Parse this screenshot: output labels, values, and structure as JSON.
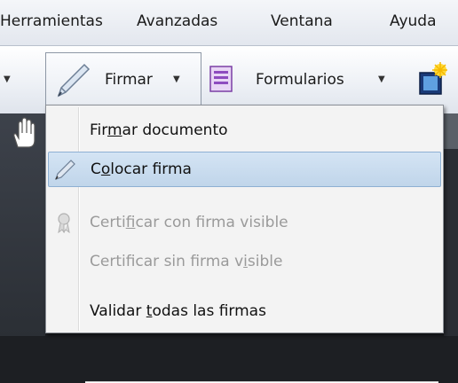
{
  "menubar": {
    "items": [
      "Herramientas",
      "Avanzadas",
      "Ventana",
      "Ayuda"
    ]
  },
  "toolbar": {
    "firmar_label": "Firmar",
    "formularios_label": "Formularios",
    "icons": [
      "pen-icon",
      "form-icon",
      "media-icon"
    ]
  },
  "menu": {
    "items": [
      {
        "pre": "Fir",
        "accel": "m",
        "post": "ar documento",
        "enabled": true,
        "highlighted": false
      },
      {
        "pre": "C",
        "accel": "o",
        "post": "locar firma",
        "enabled": true,
        "highlighted": true,
        "icon": "pen-icon"
      },
      {
        "pre": "Certi",
        "accel": "f",
        "post": "icar con firma visible",
        "enabled": false,
        "highlighted": false,
        "icon": "ribbon-icon"
      },
      {
        "pre": "Certificar sin firma v",
        "accel": "i",
        "post": "sible",
        "enabled": false,
        "highlighted": false
      },
      {
        "pre": "Validar ",
        "accel": "t",
        "post": "odas las firmas",
        "enabled": true,
        "highlighted": false
      }
    ]
  },
  "colors": {
    "highlight": "#c5d9ee",
    "disabled_text": "#9a9a9a",
    "menu_bg": "#f3f3f3"
  }
}
